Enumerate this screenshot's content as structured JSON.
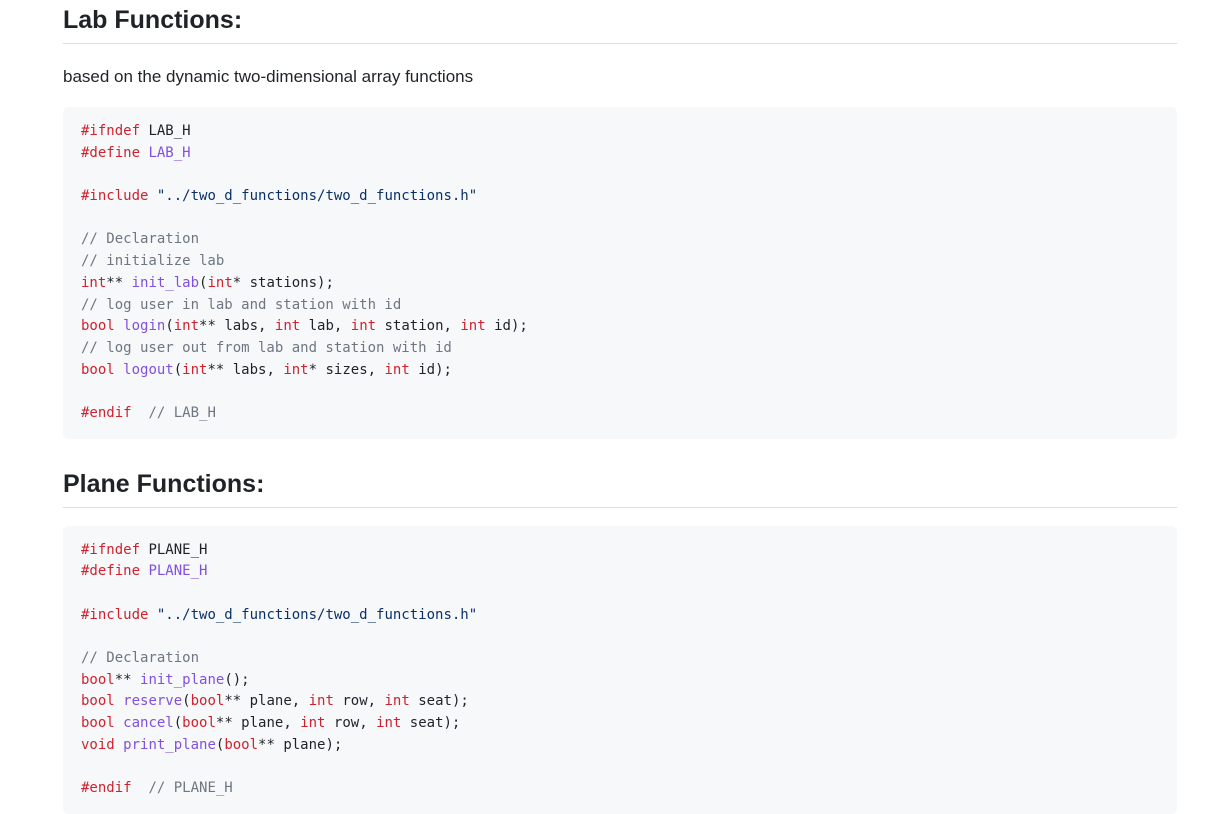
{
  "sections": [
    {
      "title": "Lab Functions:",
      "description": "based on the dynamic two-dimensional array functions",
      "code": [
        [
          [
            "kw",
            "#ifndef"
          ],
          [
            "pl",
            " LAB_H"
          ]
        ],
        [
          [
            "kw",
            "#define"
          ],
          [
            "pl",
            " "
          ],
          [
            "fn",
            "LAB_H"
          ]
        ],
        [],
        [
          [
            "kw",
            "#include"
          ],
          [
            "pl",
            " "
          ],
          [
            "st",
            "\"../two_d_functions/two_d_functions.h\""
          ]
        ],
        [],
        [
          [
            "cm",
            "// Declaration"
          ]
        ],
        [
          [
            "cm",
            "// initialize lab"
          ]
        ],
        [
          [
            "ty",
            "int"
          ],
          [
            "pl",
            "** "
          ],
          [
            "fn",
            "init_lab"
          ],
          [
            "pl",
            "("
          ],
          [
            "ty",
            "int"
          ],
          [
            "pl",
            "* stations);"
          ]
        ],
        [
          [
            "cm",
            "// log user in lab and station with id"
          ]
        ],
        [
          [
            "ty",
            "bool"
          ],
          [
            "pl",
            " "
          ],
          [
            "fn",
            "login"
          ],
          [
            "pl",
            "("
          ],
          [
            "ty",
            "int"
          ],
          [
            "pl",
            "** labs, "
          ],
          [
            "ty",
            "int"
          ],
          [
            "pl",
            " lab, "
          ],
          [
            "ty",
            "int"
          ],
          [
            "pl",
            " station, "
          ],
          [
            "ty",
            "int"
          ],
          [
            "pl",
            " id);"
          ]
        ],
        [
          [
            "cm",
            "// log user out from lab and station with id"
          ]
        ],
        [
          [
            "ty",
            "bool"
          ],
          [
            "pl",
            " "
          ],
          [
            "fn",
            "logout"
          ],
          [
            "pl",
            "("
          ],
          [
            "ty",
            "int"
          ],
          [
            "pl",
            "** labs, "
          ],
          [
            "ty",
            "int"
          ],
          [
            "pl",
            "* sizes, "
          ],
          [
            "ty",
            "int"
          ],
          [
            "pl",
            " id);"
          ]
        ],
        [],
        [
          [
            "kw",
            "#endif"
          ],
          [
            "pl",
            "  "
          ],
          [
            "cm",
            "// LAB_H"
          ]
        ]
      ]
    },
    {
      "title": "Plane Functions:",
      "description": "",
      "code": [
        [
          [
            "kw",
            "#ifndef"
          ],
          [
            "pl",
            " PLANE_H"
          ]
        ],
        [
          [
            "kw",
            "#define"
          ],
          [
            "pl",
            " "
          ],
          [
            "fn",
            "PLANE_H"
          ]
        ],
        [],
        [
          [
            "kw",
            "#include"
          ],
          [
            "pl",
            " "
          ],
          [
            "st",
            "\"../two_d_functions/two_d_functions.h\""
          ]
        ],
        [],
        [
          [
            "cm",
            "// Declaration"
          ]
        ],
        [
          [
            "ty",
            "bool"
          ],
          [
            "pl",
            "** "
          ],
          [
            "fn",
            "init_plane"
          ],
          [
            "pl",
            "();"
          ]
        ],
        [
          [
            "ty",
            "bool"
          ],
          [
            "pl",
            " "
          ],
          [
            "fn",
            "reserve"
          ],
          [
            "pl",
            "("
          ],
          [
            "ty",
            "bool"
          ],
          [
            "pl",
            "** plane, "
          ],
          [
            "ty",
            "int"
          ],
          [
            "pl",
            " row, "
          ],
          [
            "ty",
            "int"
          ],
          [
            "pl",
            " seat);"
          ]
        ],
        [
          [
            "ty",
            "bool"
          ],
          [
            "pl",
            " "
          ],
          [
            "fn",
            "cancel"
          ],
          [
            "pl",
            "("
          ],
          [
            "ty",
            "bool"
          ],
          [
            "pl",
            "** plane, "
          ],
          [
            "ty",
            "int"
          ],
          [
            "pl",
            " row, "
          ],
          [
            "ty",
            "int"
          ],
          [
            "pl",
            " seat);"
          ]
        ],
        [
          [
            "ty",
            "void"
          ],
          [
            "pl",
            " "
          ],
          [
            "fn",
            "print_plane"
          ],
          [
            "pl",
            "("
          ],
          [
            "ty",
            "bool"
          ],
          [
            "pl",
            "** plane);"
          ]
        ],
        [],
        [
          [
            "kw",
            "#endif"
          ],
          [
            "pl",
            "  "
          ],
          [
            "cm",
            "// PLANE_H"
          ]
        ]
      ]
    }
  ]
}
